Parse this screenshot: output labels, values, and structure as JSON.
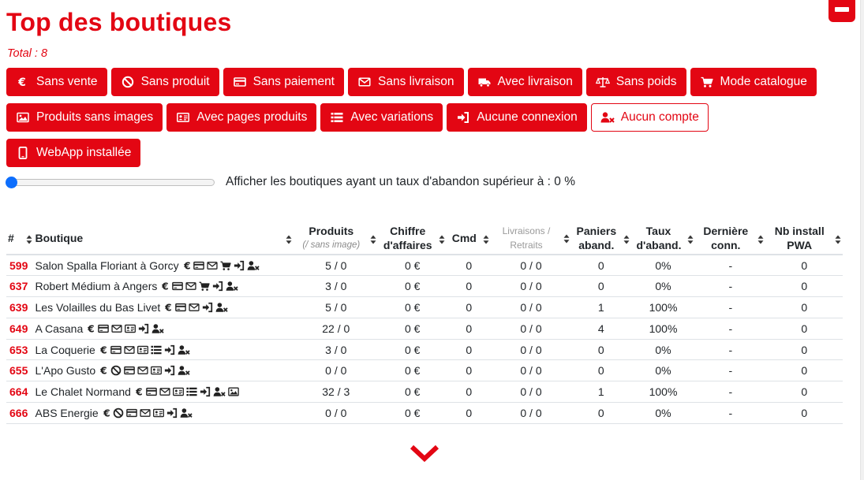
{
  "header": {
    "title": "Top des boutiques",
    "total": "Total : 8"
  },
  "filters": [
    {
      "label": "Sans vente",
      "icon": "euro-icon",
      "active": false
    },
    {
      "label": "Sans produit",
      "icon": "ban-icon",
      "active": false
    },
    {
      "label": "Sans paiement",
      "icon": "credit-card-icon",
      "active": false
    },
    {
      "label": "Sans livraison",
      "icon": "envelope-icon",
      "active": false
    },
    {
      "label": "Avec livraison",
      "icon": "truck-icon",
      "active": false
    },
    {
      "label": "Sans poids",
      "icon": "scale-icon",
      "active": false
    },
    {
      "label": "Mode catalogue",
      "icon": "cart-icon",
      "active": false
    },
    {
      "label": "Produits sans images",
      "icon": "image-icon",
      "active": false
    },
    {
      "label": "Avec pages produits",
      "icon": "id-card-icon",
      "active": false
    },
    {
      "label": "Avec variations",
      "icon": "list-icon",
      "active": false
    },
    {
      "label": "Aucune connexion",
      "icon": "sign-in-icon",
      "active": false
    },
    {
      "label": "Aucun compte",
      "icon": "user-x-icon",
      "active": true
    },
    {
      "label": "WebApp installée",
      "icon": "mobile-icon",
      "active": false
    }
  ],
  "slider": {
    "label": "Afficher les boutiques ayant un taux d'abandon supérieur à : 0 %",
    "value_percent": 0
  },
  "table": {
    "columns": {
      "num": "#",
      "boutique": "Boutique",
      "produits": "Produits",
      "produits_sub": "(/ sans image)",
      "ca": "Chiffre d'affaires",
      "cmd": "Cmd",
      "livraisons": "Livraisons / Retraits",
      "paniers": "Paniers aband.",
      "taux": "Taux d'aband.",
      "derniere": "Dernière conn.",
      "pwa": "Nb install PWA"
    },
    "rows": [
      {
        "id": "599",
        "name": "Salon Spalla Floriant à Gorcy",
        "icons": [
          "euro-icon",
          "credit-card-icon",
          "envelope-icon",
          "cart-icon",
          "sign-in-icon",
          "user-x-icon"
        ],
        "produits": "5 / 0",
        "ca": "0 €",
        "cmd": "0",
        "livraisons": "0 / 0",
        "paniers": "0",
        "taux": "0%",
        "derniere": "-",
        "pwa": "0"
      },
      {
        "id": "637",
        "name": "Robert Médium à Angers",
        "icons": [
          "euro-icon",
          "credit-card-icon",
          "envelope-icon",
          "cart-icon",
          "sign-in-icon",
          "user-x-icon"
        ],
        "produits": "3 / 0",
        "ca": "0 €",
        "cmd": "0",
        "livraisons": "0 / 0",
        "paniers": "0",
        "taux": "0%",
        "derniere": "-",
        "pwa": "0"
      },
      {
        "id": "639",
        "name": "Les Volailles du Bas Livet",
        "icons": [
          "euro-icon",
          "credit-card-icon",
          "envelope-icon",
          "sign-in-icon",
          "user-x-icon"
        ],
        "produits": "5 / 0",
        "ca": "0 €",
        "cmd": "0",
        "livraisons": "0 / 0",
        "paniers": "1",
        "taux": "100%",
        "derniere": "-",
        "pwa": "0"
      },
      {
        "id": "649",
        "name": "A Casana",
        "icons": [
          "euro-icon",
          "credit-card-icon",
          "envelope-icon",
          "id-card-icon",
          "sign-in-icon",
          "user-x-icon"
        ],
        "produits": "22 / 0",
        "ca": "0 €",
        "cmd": "0",
        "livraisons": "0 / 0",
        "paniers": "4",
        "taux": "100%",
        "derniere": "-",
        "pwa": "0"
      },
      {
        "id": "653",
        "name": "La Coquerie",
        "icons": [
          "euro-icon",
          "credit-card-icon",
          "envelope-icon",
          "id-card-icon",
          "list-icon",
          "sign-in-icon",
          "user-x-icon"
        ],
        "produits": "3 / 0",
        "ca": "0 €",
        "cmd": "0",
        "livraisons": "0 / 0",
        "paniers": "0",
        "taux": "0%",
        "derniere": "-",
        "pwa": "0"
      },
      {
        "id": "655",
        "name": "L'Apo Gusto",
        "icons": [
          "euro-icon",
          "ban-icon",
          "credit-card-icon",
          "envelope-icon",
          "id-card-icon",
          "sign-in-icon",
          "user-x-icon"
        ],
        "produits": "0 / 0",
        "ca": "0 €",
        "cmd": "0",
        "livraisons": "0 / 0",
        "paniers": "0",
        "taux": "0%",
        "derniere": "-",
        "pwa": "0"
      },
      {
        "id": "664",
        "name": "Le Chalet Normand",
        "icons": [
          "euro-icon",
          "credit-card-icon",
          "envelope-icon",
          "id-card-icon",
          "list-icon",
          "sign-in-icon",
          "user-x-icon",
          "image-icon"
        ],
        "produits": "32 / 3",
        "ca": "0 €",
        "cmd": "0",
        "livraisons": "0 / 0",
        "paniers": "1",
        "taux": "100%",
        "derniere": "-",
        "pwa": "0"
      },
      {
        "id": "666",
        "name": "ABS Energie",
        "icons": [
          "euro-icon",
          "ban-icon",
          "credit-card-icon",
          "envelope-icon",
          "id-card-icon",
          "sign-in-icon",
          "user-x-icon"
        ],
        "produits": "0 / 0",
        "ca": "0 €",
        "cmd": "0",
        "livraisons": "0 / 0",
        "paniers": "0",
        "taux": "0%",
        "derniere": "-",
        "pwa": "0"
      }
    ]
  },
  "colors": {
    "accent": "#e30613",
    "slider_thumb": "#0d6efd"
  },
  "footer": {
    "more_icon": "chevron-down-icon"
  }
}
